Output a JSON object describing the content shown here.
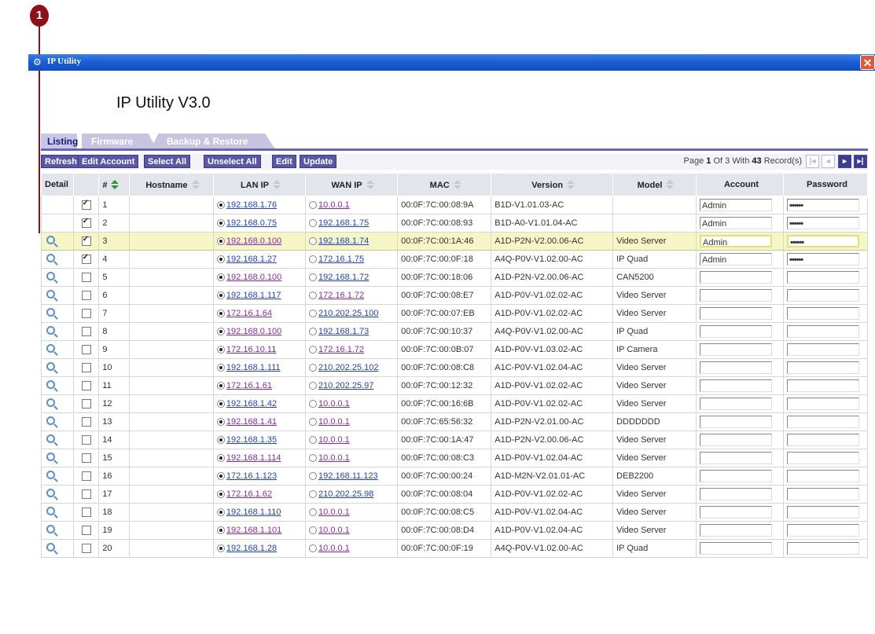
{
  "callout": {
    "number": "1"
  },
  "window": {
    "title": "IP Utility",
    "close_glyph": "✕"
  },
  "app_title": "IP Utility V3.0",
  "tabs": [
    {
      "label": "Listing",
      "active": true
    },
    {
      "label": "Firmware",
      "active": false
    },
    {
      "label": "Backup & Restore",
      "active": false
    }
  ],
  "toolbar": {
    "buttons": [
      "Refresh",
      "Edit Account",
      "Select All",
      "Unselect All",
      "Edit",
      "Update"
    ],
    "pager": {
      "prefix": "Page",
      "page": "1",
      "mid": "Of 3 With",
      "records": "43",
      "suffix": "Record(s)"
    }
  },
  "columns": {
    "detail": "Detail",
    "num": "#",
    "hostname": "Hostname",
    "lan": "LAN IP",
    "wan": "WAN IP",
    "mac": "MAC",
    "version": "Version",
    "model": "Model",
    "account": "Account",
    "password": "Password"
  },
  "rows": [
    {
      "n": "1",
      "checked": true,
      "detail": false,
      "lan": "192.168.1.76",
      "wan": "10.0.0.1",
      "mac": "00:0F:7C:00:08:9A",
      "version": "B1D-V1.01.03-AC",
      "model": "",
      "account": "Admin",
      "password": "••••••"
    },
    {
      "n": "2",
      "checked": true,
      "detail": false,
      "lan": "192.168.0.75",
      "wan": "192.168.1.75",
      "mac": "00:0F:7C:00:08:93",
      "version": "B1D-A0-V1.01.04-AC",
      "model": "",
      "account": "Admin",
      "password": "••••••"
    },
    {
      "n": "3",
      "checked": true,
      "detail": true,
      "lan": "192.168.0.100",
      "wan": "192.168.1.74",
      "mac": "00:0F:7C:00:1A:46",
      "version": "A1D-P2N-V2.00.06-AC",
      "model": "Video Server",
      "account": "Admin",
      "password": "••••••"
    },
    {
      "n": "4",
      "checked": true,
      "detail": true,
      "lan": "192.168.1.27",
      "wan": "172.16.1.75",
      "mac": "00:0F:7C:00:0F:18",
      "version": "A4Q-P0V-V1.02.00-AC",
      "model": "IP Quad",
      "account": "Admin",
      "password": "••••••"
    },
    {
      "n": "5",
      "checked": false,
      "detail": true,
      "lan": "192.168.0.100",
      "wan": "192.168.1.72",
      "mac": "00:0F:7C:00:18:06",
      "version": "A1D-P2N-V2.00.06-AC",
      "model": "CAN5200",
      "account": "",
      "password": ""
    },
    {
      "n": "6",
      "checked": false,
      "detail": true,
      "lan": "192.168.1.117",
      "wan": "172.16.1.72",
      "mac": "00:0F:7C:00:08:E7",
      "version": "A1D-P0V-V1.02.02-AC",
      "model": "Video Server",
      "account": "",
      "password": ""
    },
    {
      "n": "7",
      "checked": false,
      "detail": true,
      "lan": "172.16.1.64",
      "wan": "210.202.25.100",
      "mac": "00:0F:7C:00:07:EB",
      "version": "A1D-P0V-V1.02.02-AC",
      "model": "Video Server",
      "account": "",
      "password": ""
    },
    {
      "n": "8",
      "checked": false,
      "detail": true,
      "lan": "192.168.0.100",
      "wan": "192.168.1.73",
      "mac": "00:0F:7C:00:10:37",
      "version": "A4Q-P0V-V1.02.00-AC",
      "model": "IP Quad",
      "account": "",
      "password": ""
    },
    {
      "n": "9",
      "checked": false,
      "detail": true,
      "lan": "172.16.10.11",
      "wan": "172.16.1.72",
      "mac": "00:0F:7C:00:0B:07",
      "version": "A1D-P0V-V1.03.02-AC",
      "model": "IP Camera",
      "account": "",
      "password": ""
    },
    {
      "n": "10",
      "checked": false,
      "detail": true,
      "lan": "192.168.1.111",
      "wan": "210.202.25.102",
      "mac": "00:0F:7C:00:08:C8",
      "version": "A1C-P0V-V1.02.04-AC",
      "model": "Video Server",
      "account": "",
      "password": ""
    },
    {
      "n": "11",
      "checked": false,
      "detail": true,
      "lan": "172.16.1.61",
      "wan": "210.202.25.97",
      "mac": "00:0F:7C:00:12:32",
      "version": "A1D-P0V-V1.02.02-AC",
      "model": "Video Server",
      "account": "",
      "password": ""
    },
    {
      "n": "12",
      "checked": false,
      "detail": true,
      "lan": "192.168.1.42",
      "wan": "10.0.0.1",
      "mac": "00:0F:7C:00:16:6B",
      "version": "A1D-P0V-V1.02.02-AC",
      "model": "Video Server",
      "account": "",
      "password": ""
    },
    {
      "n": "13",
      "checked": false,
      "detail": true,
      "lan": "192.168.1.41",
      "wan": "10.0.0.1",
      "mac": "00:0F:7C:65:56:32",
      "version": "A1D-P2N-V2.01.00-AC",
      "model": "DDDDDDD",
      "account": "",
      "password": ""
    },
    {
      "n": "14",
      "checked": false,
      "detail": true,
      "lan": "192.168.1.35",
      "wan": "10.0.0.1",
      "mac": "00:0F:7C:00:1A:47",
      "version": "A1D-P2N-V2.00.06-AC",
      "model": "Video Server",
      "account": "",
      "password": ""
    },
    {
      "n": "15",
      "checked": false,
      "detail": true,
      "lan": "192.168.1.114",
      "wan": "10.0.0.1",
      "mac": "00:0F:7C:00:08:C3",
      "version": "A1D-P0V-V1.02.04-AC",
      "model": "Video Server",
      "account": "",
      "password": ""
    },
    {
      "n": "16",
      "checked": false,
      "detail": true,
      "lan": "172.16.1.123",
      "wan": "192.168.11.123",
      "mac": "00:0F:7C:00:00:24",
      "version": "A1D-M2N-V2.01.01-AC",
      "model": "DEB2200",
      "account": "",
      "password": ""
    },
    {
      "n": "17",
      "checked": false,
      "detail": true,
      "lan": "172.16.1.62",
      "wan": "210.202.25.98",
      "mac": "00:0F:7C:00:08:04",
      "version": "A1D-P0V-V1.02.02-AC",
      "model": "Video Server",
      "account": "",
      "password": ""
    },
    {
      "n": "18",
      "checked": false,
      "detail": true,
      "lan": "192.168.1.110",
      "wan": "10.0.0.1",
      "mac": "00:0F:7C:00:08:C5",
      "version": "A1D-P0V-V1.02.04-AC",
      "model": "Video Server",
      "account": "",
      "password": ""
    },
    {
      "n": "19",
      "checked": false,
      "detail": true,
      "lan": "192.168.1.101",
      "wan": "10.0.0.1",
      "mac": "00:0F:7C:00:08:D4",
      "version": "A1D-P0V-V1.02.04-AC",
      "model": "Video Server",
      "account": "",
      "password": ""
    },
    {
      "n": "20",
      "checked": false,
      "detail": true,
      "lan": "192.168.1.28",
      "wan": "10.0.0.1",
      "mac": "00:0F:7C:00:0F:19",
      "version": "A4Q-P0V-V1.02.00-AC",
      "model": "IP Quad",
      "account": "",
      "password": ""
    }
  ],
  "highlighted_row": "3",
  "colors": {
    "titlebar": "#1c5fd4",
    "tab_accent": "#6b66b4",
    "button_bg": "#5a57a6",
    "highlight_row": "#f5f5c6",
    "callout": "#8e1018"
  }
}
